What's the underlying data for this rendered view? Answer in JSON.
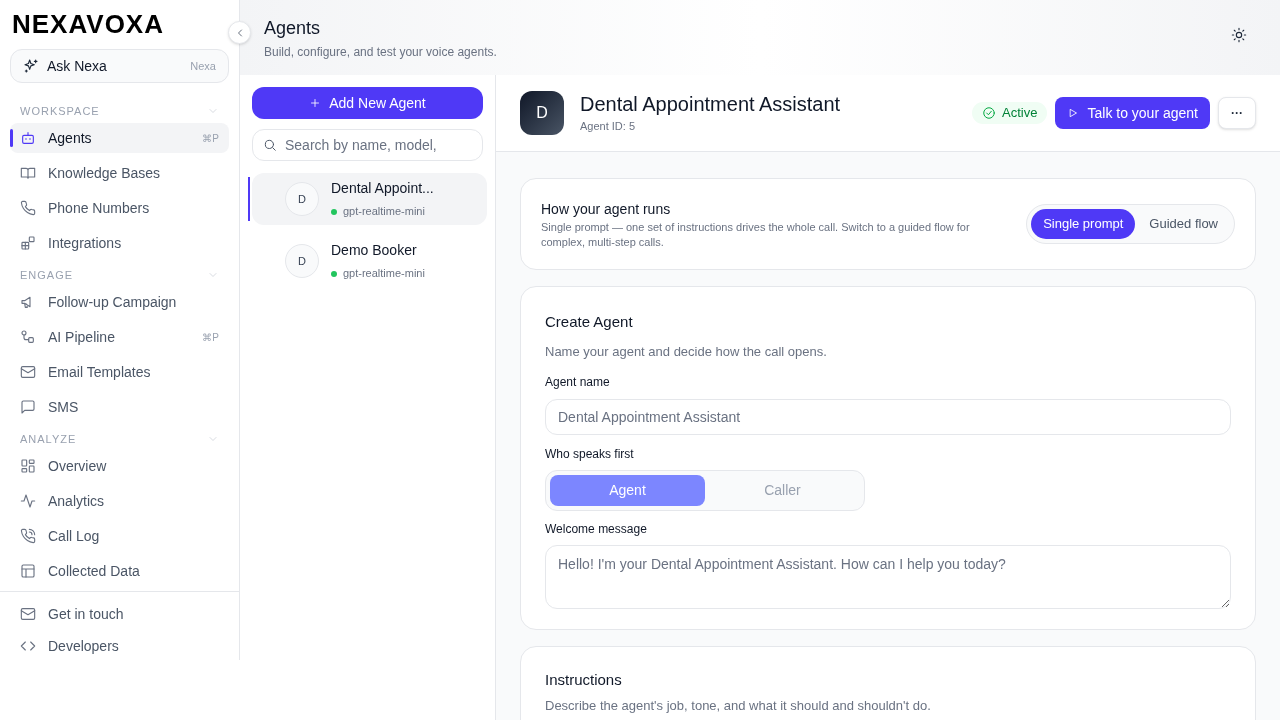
{
  "sidebar": {
    "logo": "NEXAVOXA",
    "ask": {
      "label": "Ask Nexa",
      "shortcut": "Nexa"
    },
    "sections": [
      {
        "title": "WORKSPACE",
        "expanded": true,
        "items": [
          {
            "label": "Agents",
            "selected": true,
            "shortcut": "⌘P"
          },
          {
            "label": "Knowledge Bases",
            "selected": false
          },
          {
            "label": "Phone Numbers",
            "selected": false
          },
          {
            "label": "Integrations",
            "selected": false
          }
        ]
      },
      {
        "title": "ENGAGE",
        "expanded": true,
        "items": [
          {
            "label": "Follow-up Campaign",
            "selected": false
          },
          {
            "label": "AI Pipeline",
            "selected": false,
            "shortcut": "⌘P"
          },
          {
            "label": "Email Templates",
            "selected": false
          },
          {
            "label": "SMS",
            "selected": false
          }
        ]
      },
      {
        "title": "ANALYZE",
        "expanded": true,
        "items": [
          {
            "label": "Overview",
            "selected": false
          },
          {
            "label": "Analytics",
            "selected": false
          },
          {
            "label": "Call Log",
            "selected": false
          },
          {
            "label": "Collected Data",
            "selected": false
          }
        ]
      }
    ],
    "footer": [
      {
        "label": "Get in touch"
      },
      {
        "label": "Developers"
      }
    ]
  },
  "header": {
    "title": "Agents",
    "subtitle": "Build, configure, and test your voice agents."
  },
  "agent_list": {
    "add_button": "Add New Agent",
    "search": {
      "placeholder": "Search by name, model,"
    },
    "agents": [
      {
        "initial": "D",
        "name": "Dental Appoint...",
        "model": "gpt-realtime-mini",
        "selected": true,
        "color": "#22c55e"
      },
      {
        "initial": "D",
        "name": "Demo Booker",
        "model": "gpt-realtime-mini",
        "selected": false,
        "color": "#22c55e"
      }
    ]
  },
  "agent": {
    "initial": "D",
    "name": "Dental Appointment Assistant",
    "id": "Agent ID: 5",
    "status": "Active",
    "talk_button": "Talk to your agent",
    "more_button": "···"
  },
  "run_mode": {
    "title": "How your agent runs",
    "description": "Single prompt — one set of instructions drives the whole call. Switch to a guided flow for complex, multi-step calls.",
    "options": [
      {
        "label": "Single prompt",
        "selected": true
      },
      {
        "label": "Guided flow",
        "selected": false
      }
    ]
  },
  "create": {
    "title": "Create Agent",
    "description": "Name your agent and decide how the call opens.",
    "name_label": "Agent name",
    "name_field": {
      "placeholder": "Dental Appointment Assistant"
    },
    "speaks_label": "Who speaks first",
    "speaks_options": [
      {
        "label": "Agent",
        "selected": true
      },
      {
        "label": "Caller",
        "selected": false
      }
    ],
    "welcome_label": "Welcome message",
    "welcome_field": {
      "placeholder": "Hello! I'm your Dental Appointment Assistant. How can I help you today?"
    }
  },
  "instructions": {
    "title": "Instructions",
    "description": "Describe the agent's job, tone, and what it should and shouldn't do."
  }
}
